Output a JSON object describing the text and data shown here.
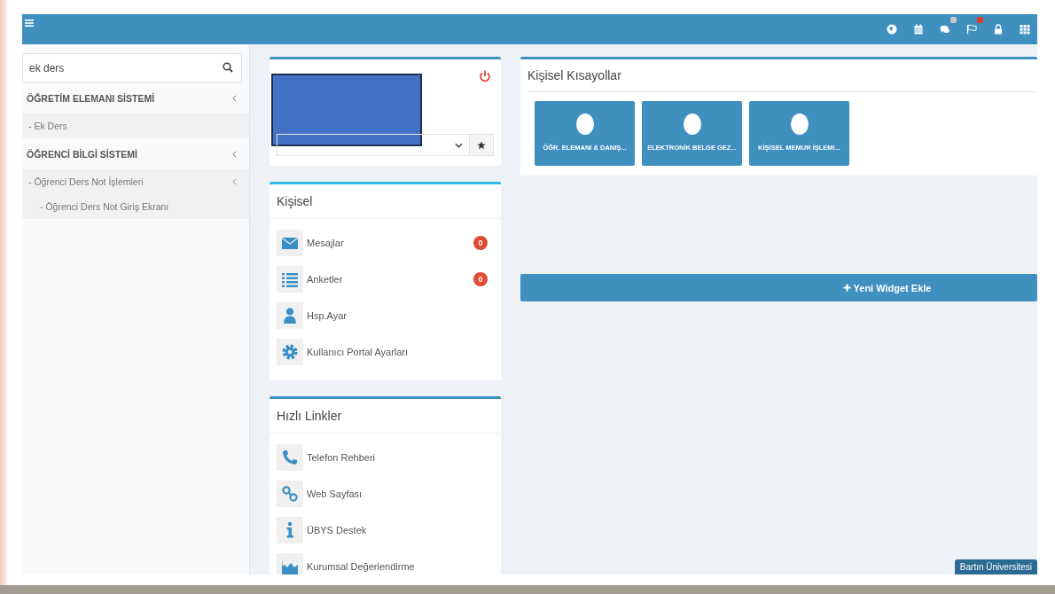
{
  "topbar": {
    "icons": [
      {
        "kind": "globe",
        "badge": false
      },
      {
        "kind": "calendar",
        "badge": false
      },
      {
        "kind": "chat",
        "badge": true
      },
      {
        "kind": "flag",
        "badge": true
      },
      {
        "kind": "lock",
        "badge": false
      },
      {
        "kind": "grid",
        "badge": false
      }
    ]
  },
  "sidebar": {
    "search": {
      "value": "ek ders"
    },
    "items": [
      {
        "label": "ÖĞRETİM ELEMANI SİSTEMİ",
        "children": [
          {
            "label": "- Ek Ders"
          }
        ]
      },
      {
        "label": "ÖĞRENCİ BİLGİ SİSTEMİ",
        "children": [
          {
            "label": "- Öğrenci Ders Not İşlemleri",
            "children": [
              {
                "label": "- Öğrenci Ders Not Giriş Ekranı"
              }
            ]
          }
        ]
      }
    ]
  },
  "kisisel": {
    "title": "Kişisel",
    "items": [
      {
        "kind": "envelope",
        "label": "Mesajlar",
        "count": "0"
      },
      {
        "kind": "list",
        "label": "Anketler",
        "count": "0"
      },
      {
        "kind": "user",
        "label": "Hsp.Ayar"
      },
      {
        "kind": "gear",
        "label": "Kullanıcı Portal Ayarları"
      }
    ]
  },
  "hizli_linkler": {
    "title": "Hızlı Linkler",
    "items": [
      {
        "kind": "phone",
        "label": "Telefon Rehberi"
      },
      {
        "kind": "link",
        "label": "Web Sayfası"
      },
      {
        "kind": "info",
        "label": "ÜBYS Destek"
      },
      {
        "kind": "chart",
        "label": "Kurumsal Değerlendirme"
      }
    ]
  },
  "shortcuts": {
    "title": "Kişisel Kısayollar",
    "tiles": [
      "ÖĞR. ELEMANI & DANIŞ...",
      "ELEKTRONİK BELGE GEZ...",
      "KİŞİSEL MEMUR İŞLEMl..."
    ]
  },
  "add_widget": "Yeni Widget Ekle",
  "footer_badge": "Bartın Üniversitesi"
}
